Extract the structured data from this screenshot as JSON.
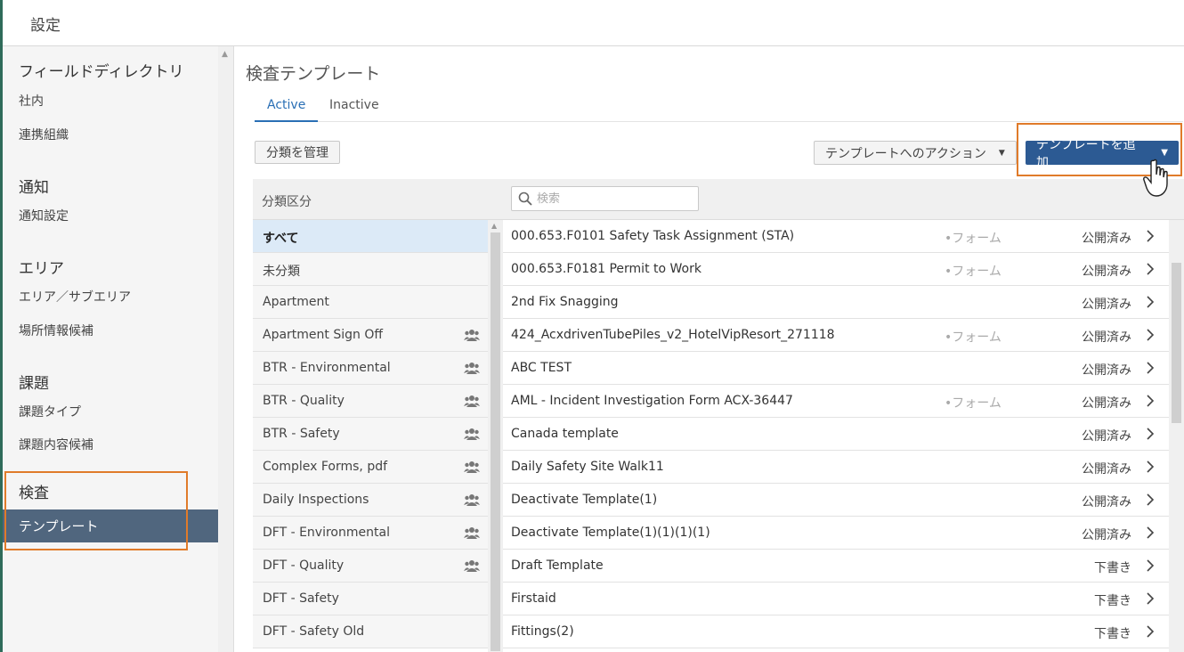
{
  "app": {
    "title": "設定"
  },
  "sidebar": {
    "sections": [
      {
        "heading": "フィールドディレクトリ",
        "items": [
          "社内",
          "連携組織"
        ]
      },
      {
        "heading": "通知",
        "items": [
          "通知設定"
        ]
      },
      {
        "heading": "エリア",
        "items": [
          "エリア／サブエリア",
          "場所情報候補"
        ]
      },
      {
        "heading": "課題",
        "items": [
          "課題タイプ",
          "課題内容候補"
        ]
      },
      {
        "heading": "検査",
        "items": [
          "テンプレート"
        ]
      }
    ],
    "active_item": "テンプレート"
  },
  "main": {
    "title": "検査テンプレート",
    "tabs": [
      {
        "label": "Active",
        "active": true
      },
      {
        "label": "Inactive",
        "active": false
      }
    ],
    "toolbar": {
      "manage_label": "分類を管理",
      "actions_label": "テンプレートへのアクション",
      "add_label": "テンプレートを追加"
    },
    "categories": {
      "header": "分類区分",
      "items": [
        {
          "label": "すべて",
          "selected": true,
          "shared": false
        },
        {
          "label": "未分類",
          "selected": false,
          "shared": false
        },
        {
          "label": "Apartment",
          "selected": false,
          "shared": false
        },
        {
          "label": "Apartment Sign Off",
          "selected": false,
          "shared": true
        },
        {
          "label": "BTR - Environmental",
          "selected": false,
          "shared": true
        },
        {
          "label": "BTR - Quality",
          "selected": false,
          "shared": true
        },
        {
          "label": "BTR - Safety",
          "selected": false,
          "shared": true
        },
        {
          "label": "Complex Forms, pdf",
          "selected": false,
          "shared": true
        },
        {
          "label": "Daily Inspections",
          "selected": false,
          "shared": true
        },
        {
          "label": "DFT - Environmental",
          "selected": false,
          "shared": true
        },
        {
          "label": "DFT - Quality",
          "selected": false,
          "shared": true
        },
        {
          "label": "DFT - Safety",
          "selected": false,
          "shared": false
        },
        {
          "label": "DFT - Safety Old",
          "selected": false,
          "shared": false
        }
      ]
    },
    "search": {
      "placeholder": "検索",
      "value": ""
    },
    "templates": [
      {
        "name": "000.653.F0101 Safety Task Assignment (STA)",
        "form": "•フォーム",
        "status": "公開済み"
      },
      {
        "name": "000.653.F0181 Permit to Work",
        "form": "•フォーム",
        "status": "公開済み"
      },
      {
        "name": "2nd Fix Snagging",
        "form": "",
        "status": "公開済み"
      },
      {
        "name": "424_AcxdrivenTubePiles_v2_HotelVipResort_271118",
        "form": "•フォーム",
        "status": "公開済み"
      },
      {
        "name": "ABC TEST",
        "form": "",
        "status": "公開済み"
      },
      {
        "name": "AML - Incident Investigation Form ACX-36447",
        "form": "•フォーム",
        "status": "公開済み"
      },
      {
        "name": "Canada template",
        "form": "",
        "status": "公開済み"
      },
      {
        "name": "Daily Safety Site Walk11",
        "form": "",
        "status": "公開済み"
      },
      {
        "name": "Deactivate Template(1)",
        "form": "",
        "status": "公開済み"
      },
      {
        "name": "Deactivate Template(1)(1)(1)(1)",
        "form": "",
        "status": "公開済み"
      },
      {
        "name": "Draft Template",
        "form": "",
        "status": "下書き"
      },
      {
        "name": "Firstaid",
        "form": "",
        "status": "下書き"
      },
      {
        "name": "Fittings(2)",
        "form": "",
        "status": "下書き"
      }
    ]
  },
  "colors": {
    "accent": "#2a6fb5",
    "primary_button": "#2c5a93",
    "nav_active": "#50667e",
    "highlight": "#e07b2a",
    "selected_row": "#dceaf7"
  }
}
